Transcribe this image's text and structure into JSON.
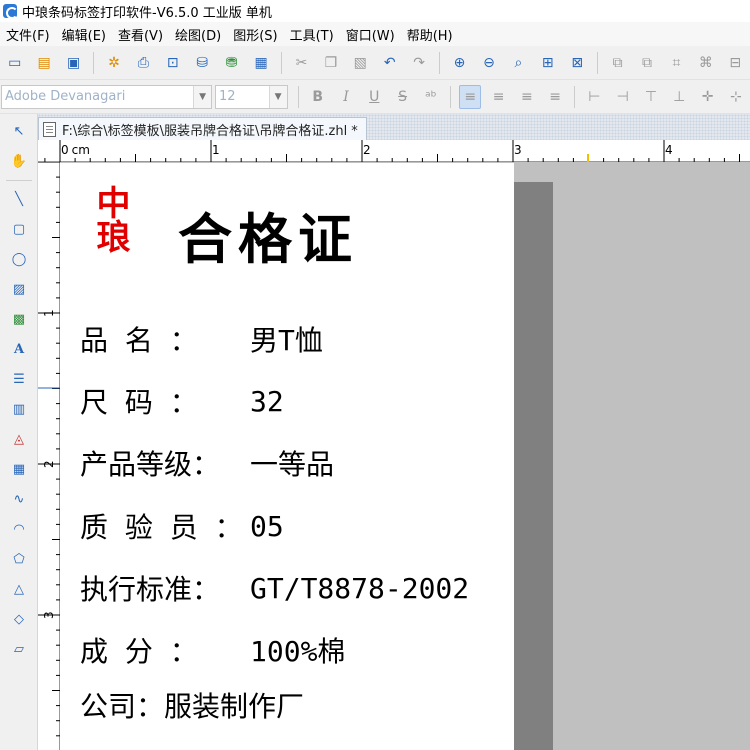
{
  "window": {
    "title": "中琅条码标签打印软件-V6.5.0 工业版 单机"
  },
  "menu": [
    "文件(F)",
    "编辑(E)",
    "查看(V)",
    "绘图(D)",
    "图形(S)",
    "工具(T)",
    "窗口(W)",
    "帮助(H)"
  ],
  "font_toolbar": {
    "font_name": "Adobe Devanagari",
    "font_size": "12"
  },
  "tab": {
    "title": "F:\\综合\\标签模板\\服装吊牌合格证\\吊牌合格证.zhl *"
  },
  "ruler": {
    "unit": "cm",
    "h_marks": [
      "0",
      "1",
      "2",
      "3",
      "4"
    ],
    "v_marks": [
      "1",
      "2",
      "3"
    ]
  },
  "label": {
    "logo": "中琅",
    "title": "合格证",
    "fields": [
      {
        "key": "品   名  ：",
        "value": "男T恤"
      },
      {
        "key": "尺   码  ：",
        "value": "32"
      },
      {
        "key": "产品等级：",
        "value": "一等品"
      },
      {
        "key": "质 验 员 ：",
        "value": "05"
      },
      {
        "key": "执行标准：",
        "value": "GT/T8878-2002"
      },
      {
        "key": "成   分  ：",
        "value": "100%棉"
      }
    ],
    "company": "公司：服装制作厂"
  },
  "colors": {
    "logo": "#e00000",
    "accent": "#2866b8"
  }
}
